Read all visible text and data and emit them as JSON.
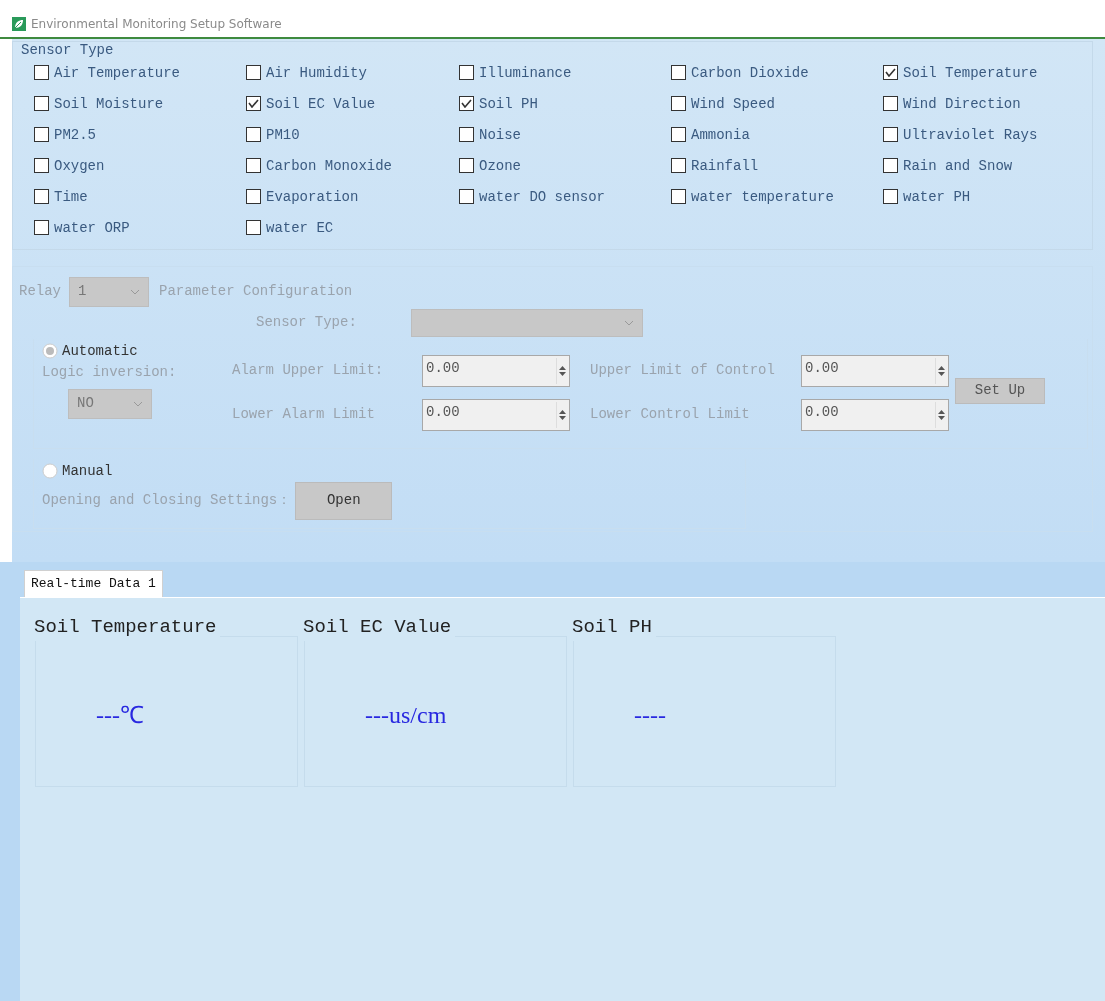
{
  "window": {
    "title": "Environmental Monitoring Setup Software"
  },
  "sensor_group": {
    "title": "Sensor Type",
    "sensors": [
      {
        "label": "Air Temperature",
        "checked": false
      },
      {
        "label": "Air Humidity",
        "checked": false
      },
      {
        "label": "Illuminance",
        "checked": false
      },
      {
        "label": "Carbon Dioxide",
        "checked": false
      },
      {
        "label": "Soil Temperature",
        "checked": true
      },
      {
        "label": "Soil Moisture",
        "checked": false
      },
      {
        "label": "Soil EC Value",
        "checked": true
      },
      {
        "label": "Soil PH",
        "checked": true
      },
      {
        "label": "Wind Speed",
        "checked": false
      },
      {
        "label": "Wind Direction",
        "checked": false
      },
      {
        "label": "PM2.5",
        "checked": false
      },
      {
        "label": "PM10",
        "checked": false
      },
      {
        "label": "Noise",
        "checked": false
      },
      {
        "label": "Ammonia",
        "checked": false
      },
      {
        "label": "Ultraviolet Rays",
        "checked": false
      },
      {
        "label": "Oxygen",
        "checked": false
      },
      {
        "label": "Carbon Monoxide",
        "checked": false
      },
      {
        "label": "Ozone",
        "checked": false
      },
      {
        "label": "Rainfall",
        "checked": false
      },
      {
        "label": "Rain and Snow",
        "checked": false
      },
      {
        "label": "Time",
        "checked": false
      },
      {
        "label": "Evaporation",
        "checked": false
      },
      {
        "label": "water DO sensor",
        "checked": false
      },
      {
        "label": "water temperature",
        "checked": false
      },
      {
        "label": "water PH",
        "checked": false
      },
      {
        "label": "water ORP",
        "checked": false
      },
      {
        "label": "water EC",
        "checked": false
      }
    ]
  },
  "relay": {
    "label": "Relay",
    "select": "1",
    "config_label": "Parameter Configuration",
    "sensor_type_label": "Sensor Type:",
    "modes": [
      {
        "label": "Automatic",
        "selected": true
      },
      {
        "label": "Manual",
        "selected": false
      }
    ],
    "logic_label": "Logic inversion:",
    "logic_select": "NO",
    "limits": [
      {
        "label": "Alarm Upper Limit:",
        "value": "0.00"
      },
      {
        "label": "Upper Limit of Control",
        "value": "0.00"
      },
      {
        "label": "Lower Alarm Limit",
        "value": "0.00"
      },
      {
        "label": "Lower Control Limit",
        "value": "0.00"
      }
    ],
    "set_button": "Set Up",
    "switch_label": "Opening and Closing Settings：",
    "switch_button": "Open"
  },
  "tabs": [
    {
      "label": "Real-time Data 1",
      "selected": true
    }
  ],
  "readings": [
    {
      "name": "Soil Temperature",
      "value": "---℃"
    },
    {
      "name": "Soil EC Value",
      "value": "---us/cm"
    },
    {
      "name": "Soil PH",
      "value": "----"
    }
  ]
}
